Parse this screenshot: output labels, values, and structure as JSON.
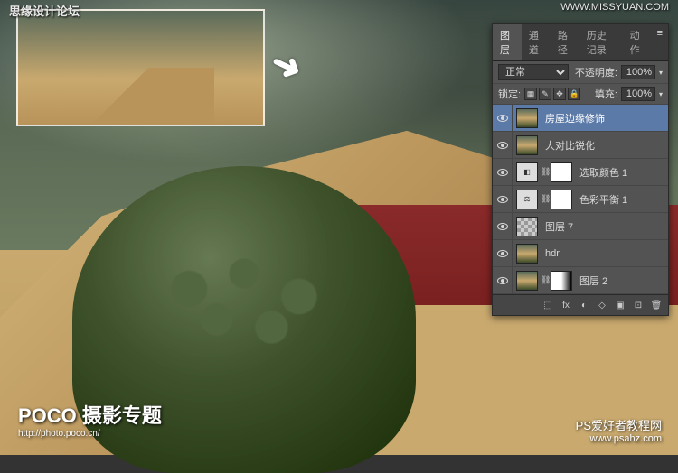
{
  "watermarks": {
    "top_left": "思缘设计论坛",
    "top_right": "WWW.MISSYUAN.COM",
    "bottom_left_main": "POCO 摄影专题",
    "bottom_left_sub": "http://photo.poco.cn/",
    "bottom_right_main": "PS爱好者教程网",
    "bottom_right_sub": "www.psahz.com"
  },
  "arrow_glyph": "➜",
  "panel": {
    "tabs": [
      "图层",
      "通道",
      "路径",
      "历史记录",
      "动作"
    ],
    "active_tab": 0,
    "blend_mode": "正常",
    "opacity_label": "不透明度:",
    "opacity_value": "100%",
    "lock_label": "锁定:",
    "fill_label": "填充:",
    "fill_value": "100%",
    "layers": [
      {
        "name": "房屋边缘修饰",
        "type": "image",
        "selected": true
      },
      {
        "name": "大对比锐化",
        "type": "image"
      },
      {
        "name": "选取颜色 1",
        "type": "adjust",
        "icon": "◧",
        "mask": "white"
      },
      {
        "name": "色彩平衡 1",
        "type": "adjust",
        "icon": "⚖",
        "mask": "white"
      },
      {
        "name": "图层 7",
        "type": "checker"
      },
      {
        "name": "hdr",
        "type": "image"
      },
      {
        "name": "图层 2",
        "type": "image",
        "mask": "grad"
      }
    ],
    "footer_icons": [
      "⬚",
      "fx",
      "◐",
      "◇",
      "▣",
      "⊡",
      "🗑"
    ]
  }
}
